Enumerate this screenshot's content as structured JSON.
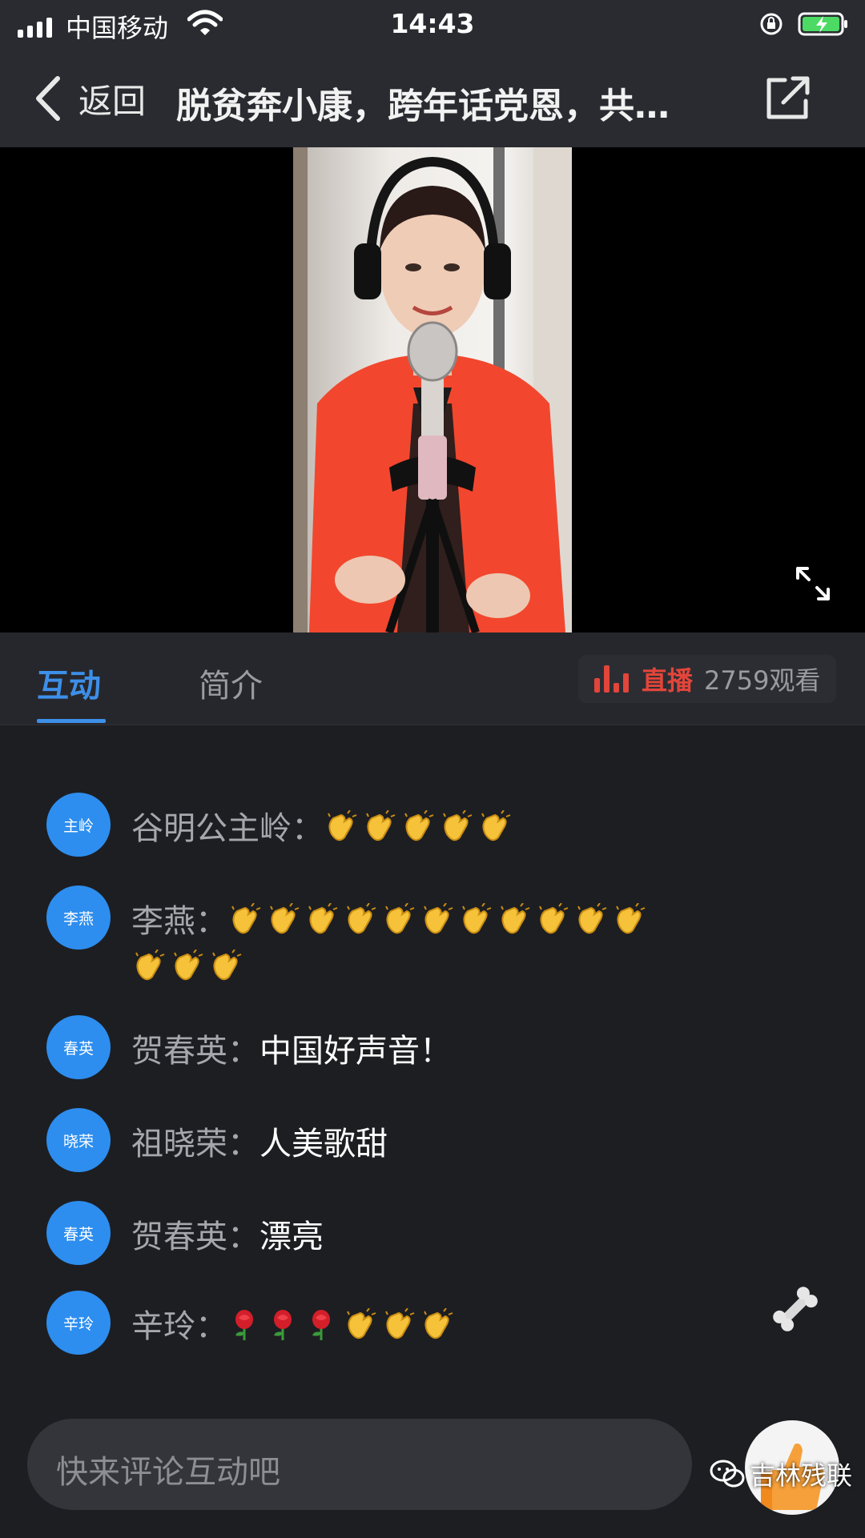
{
  "status_bar": {
    "carrier": "中国移动",
    "time": "14:43"
  },
  "nav": {
    "back_label": "返回",
    "title": "脱贫奔小康，跨年话党恩，共…"
  },
  "tabs": [
    {
      "label": "互动",
      "active": true
    },
    {
      "label": "简介",
      "active": false
    }
  ],
  "live": {
    "label": "直播",
    "viewers": "2759观看"
  },
  "comments": [
    {
      "avatar": "主岭",
      "name": "谷明公主岭：",
      "text": "",
      "emoji": [
        "clap",
        "clap",
        "clap",
        "clap",
        "clap"
      ]
    },
    {
      "avatar": "李燕",
      "name": "李燕：",
      "text": "",
      "emoji": [
        "clap",
        "clap",
        "clap",
        "clap",
        "clap",
        "clap",
        "clap",
        "clap",
        "clap",
        "clap",
        "clap",
        "clap",
        "clap",
        "clap"
      ]
    },
    {
      "avatar": "春英",
      "name": "贺春英：",
      "text": "中国好声音！",
      "emoji": []
    },
    {
      "avatar": "晓荣",
      "name": "祖晓荣：",
      "text": "人美歌甜",
      "emoji": []
    },
    {
      "avatar": "春英",
      "name": "贺春英：",
      "text": "漂亮",
      "emoji": []
    },
    {
      "avatar": "辛玲",
      "name": "辛玲：",
      "text": "",
      "emoji": [
        "rose",
        "rose",
        "rose",
        "clap",
        "clap",
        "clap"
      ]
    }
  ],
  "input": {
    "placeholder": "快来评论互动吧"
  },
  "watermark": "吉林残联",
  "colors": {
    "accent_blue": "#3d8fe8",
    "live_red": "#e2453a",
    "avatar_blue": "#2d8eef",
    "background": "#1d1e22"
  },
  "icons": [
    "signal-icon",
    "wifi-icon",
    "orientation-lock-icon",
    "battery-charging-icon",
    "chevron-left-icon",
    "share-icon",
    "fullscreen-icon",
    "live-bars-icon",
    "bone-icon",
    "thumbs-up-icon",
    "wechat-icon"
  ]
}
